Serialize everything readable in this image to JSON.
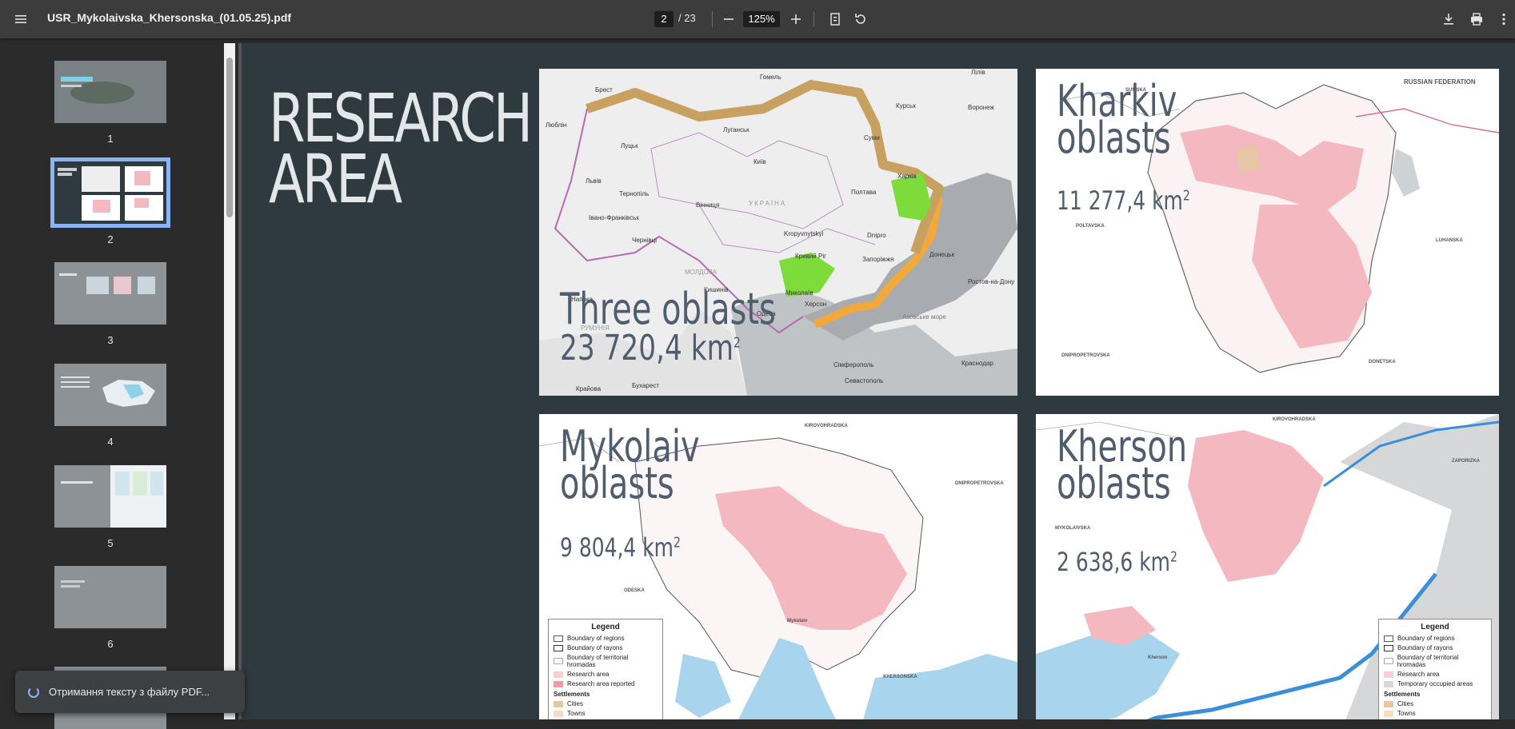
{
  "toolbar": {
    "menu_icon": "hamburger-menu-icon",
    "file_title": "USR_Mykolaivska_Khersonska_(01.05.25).pdf",
    "current_page": "2",
    "total_pages": "/ 23",
    "zoom": "125%",
    "icons": [
      "zoom-out-icon",
      "zoom-in-icon",
      "fit-page-icon",
      "rotate-icon",
      "download-icon",
      "print-icon",
      "more-vert-icon"
    ]
  },
  "sidebar": {
    "thumbnails": [
      {
        "num": "1"
      },
      {
        "num": "2",
        "selected": true
      },
      {
        "num": "3"
      },
      {
        "num": "4"
      },
      {
        "num": "5"
      },
      {
        "num": "6"
      }
    ]
  },
  "document": {
    "heading": "RESEARCH\nAREA",
    "panels": {
      "three": {
        "title": "Three oblasts",
        "area": "23 720,4 km",
        "labels": [
          "Гомель",
          "Брест",
          "Люблін",
          "Луцьк",
          "Київ",
          "Суми",
          "Курськ",
          "Воронеж",
          "Харків",
          "Львів",
          "Тернопіль",
          "Вінниця",
          "УКРАЇНА",
          "Полтава",
          "Івано-Франківськ",
          "Чернівці",
          "Kropyvnytskyi",
          "Dnipro",
          "Кривий Ріг",
          "Запоріжжя",
          "Донецьк",
          "Ростов-на-Дону",
          "МОЛДОВА",
          "Кишинів",
          "Миколаїв",
          "Херсон",
          "Одеса",
          "РУМУНІЯ",
          "Азовське море",
          "Сімферополь",
          "Краснодар",
          "Севастополь",
          "Бухарест",
          "Крайова",
          "Напока",
          "Лілів",
          "Луганськ"
        ]
      },
      "kharkiv": {
        "title": "Kharkiv\noblasts",
        "area": "11 277,4 km",
        "labels": [
          "SUMSKA",
          "RUSSIAN FEDERATION",
          "POLTAVSKA",
          "LUHANSKA",
          "DNIPROPETROVSKA",
          "DONETSKA"
        ]
      },
      "mykolaiv": {
        "title": "Mykolaiv\noblasts",
        "area": "9 804,4 km",
        "labels": [
          "KIROVOHRADSKA",
          "DNIPROPETROVSKA",
          "ODESKA",
          "KHERSONSKA",
          "Mykolaiv"
        ]
      },
      "kherson": {
        "title": "Kherson\noblasts",
        "area": "2 638,6 km",
        "labels": [
          "KIROVOHRADSKA",
          "ZAPORIZKA",
          "MYKOLAIVSKA",
          "Kherson"
        ]
      }
    },
    "area_unit_sup": "2",
    "legend_mykolaiv": {
      "title": "Legend",
      "items": [
        "Boundary of regions",
        "Boundary of rayons",
        "Boundary of territorial hromadas",
        "Research area",
        "Research area reported"
      ],
      "settlements_title": "Settlements",
      "settlements": [
        "Cities",
        "Towns"
      ]
    },
    "legend_kherson": {
      "title": "Legend",
      "items": [
        "Boundary of regions",
        "Boundary of rayons",
        "Boundary of territorial hromadas",
        "Research area",
        "Temporary occupied areas"
      ],
      "settlements_title": "Settlements",
      "settlements": [
        "Cities",
        "Towns"
      ]
    }
  },
  "toast": {
    "text": "Отримання тексту з файлу PDF..."
  },
  "colors": {
    "toolbar": "#3c3c3c",
    "page_bg": "#2f3a40",
    "research": "#f4b8c0",
    "selection": "#8ab4f8"
  }
}
